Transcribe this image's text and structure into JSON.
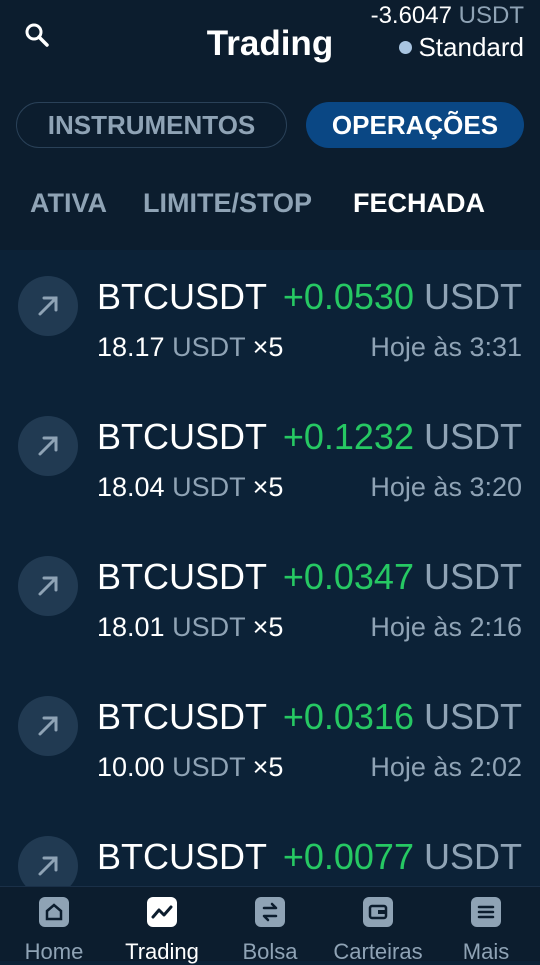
{
  "header": {
    "title": "Trading",
    "balance_value": "-3.6047",
    "balance_unit": "USDT",
    "account_type": "Standard"
  },
  "segments": {
    "instruments": "INSTRUMENTOS",
    "operations": "OPERAÇÕES"
  },
  "filters": {
    "active": "ATIVA",
    "limit_stop": "LIMITE/STOP",
    "closed": "FECHADA"
  },
  "trades": [
    {
      "symbol": "BTCUSDT",
      "pnl": "+0.0530",
      "pnl_unit": "USDT",
      "amount": "18.17",
      "amount_unit": "USDT",
      "leverage": "×5",
      "time": "Hoje às 3:31"
    },
    {
      "symbol": "BTCUSDT",
      "pnl": "+0.1232",
      "pnl_unit": "USDT",
      "amount": "18.04",
      "amount_unit": "USDT",
      "leverage": "×5",
      "time": "Hoje às 3:20"
    },
    {
      "symbol": "BTCUSDT",
      "pnl": "+0.0347",
      "pnl_unit": "USDT",
      "amount": "18.01",
      "amount_unit": "USDT",
      "leverage": "×5",
      "time": "Hoje às 2:16"
    },
    {
      "symbol": "BTCUSDT",
      "pnl": "+0.0316",
      "pnl_unit": "USDT",
      "amount": "10.00",
      "amount_unit": "USDT",
      "leverage": "×5",
      "time": "Hoje às 2:02"
    },
    {
      "symbol": "BTCUSDT",
      "pnl": "+0.0077",
      "pnl_unit": "USDT"
    }
  ],
  "nav": {
    "home": "Home",
    "trading": "Trading",
    "exchange": "Bolsa",
    "wallets": "Carteiras",
    "more": "Mais"
  },
  "colors": {
    "profit": "#26c863",
    "accent": "#0a4784",
    "background": "#0c2237"
  }
}
